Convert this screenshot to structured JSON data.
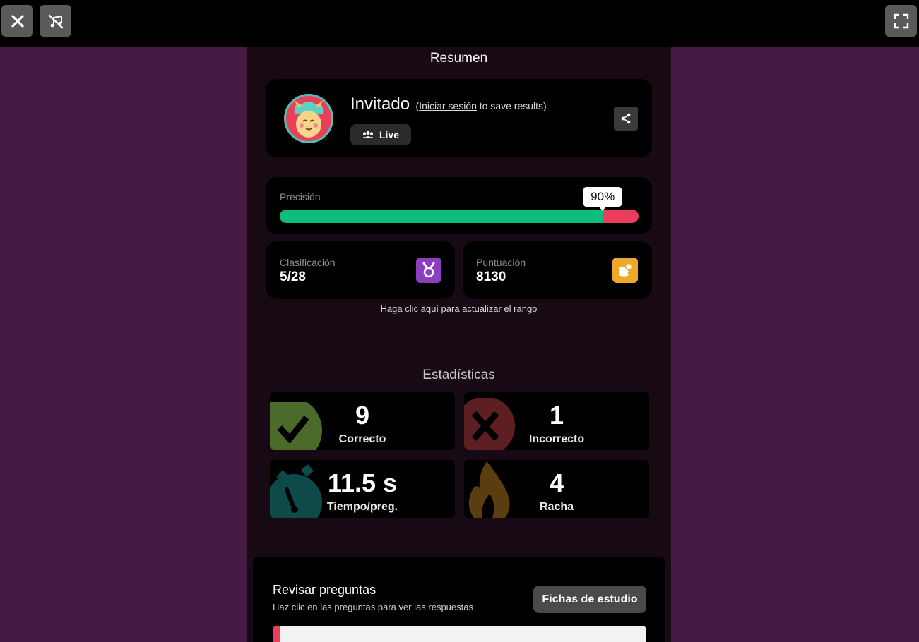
{
  "topbar": {
    "close_icon": "close-icon",
    "music_off_icon": "music-off-icon",
    "fullscreen_icon": "fullscreen-icon"
  },
  "summary": {
    "title": "Resumen",
    "player": {
      "name": "Invitado",
      "login_prefix": "(",
      "login_link": "Iniciar sesión",
      "login_suffix": " to save results)",
      "mode_label": "Live",
      "avatar_icon": "avatar-llama-icon",
      "share_icon": "share-icon"
    },
    "accuracy": {
      "label": "Precisión",
      "value_label": "90%",
      "value": 0.9,
      "correct_color": "#0cbd7d",
      "incorrect_color": "#ec3d5f"
    },
    "rank": {
      "label": "Clasificación",
      "value": "5/28",
      "icon": "medal-icon",
      "icon_color": "#8b3fc0"
    },
    "score": {
      "label": "Puntuación",
      "value": "8130",
      "icon": "coins-icon",
      "icon_color": "#efa929"
    },
    "update_rank_link": "Haga clic aquí para actualizar el rango"
  },
  "stats": {
    "title": "Estadísticas",
    "items": [
      {
        "value": "9",
        "label": "Correcto",
        "icon": "check-icon",
        "color": "#4a6b2a"
      },
      {
        "value": "1",
        "label": "Incorrecto",
        "icon": "cross-icon",
        "color": "#5e1f22"
      },
      {
        "value": "11.5 s",
        "label": "Tiempo/preg.",
        "icon": "stopwatch-icon",
        "color": "#0f4a4a"
      },
      {
        "value": "4",
        "label": "Racha",
        "icon": "fire-icon",
        "color": "#5a3d10"
      }
    ]
  },
  "review": {
    "title": "Revisar preguntas",
    "subtitle": "Haz clic en las preguntas para ver las respuestas",
    "flashcards_button": "Fichas de estudio"
  }
}
